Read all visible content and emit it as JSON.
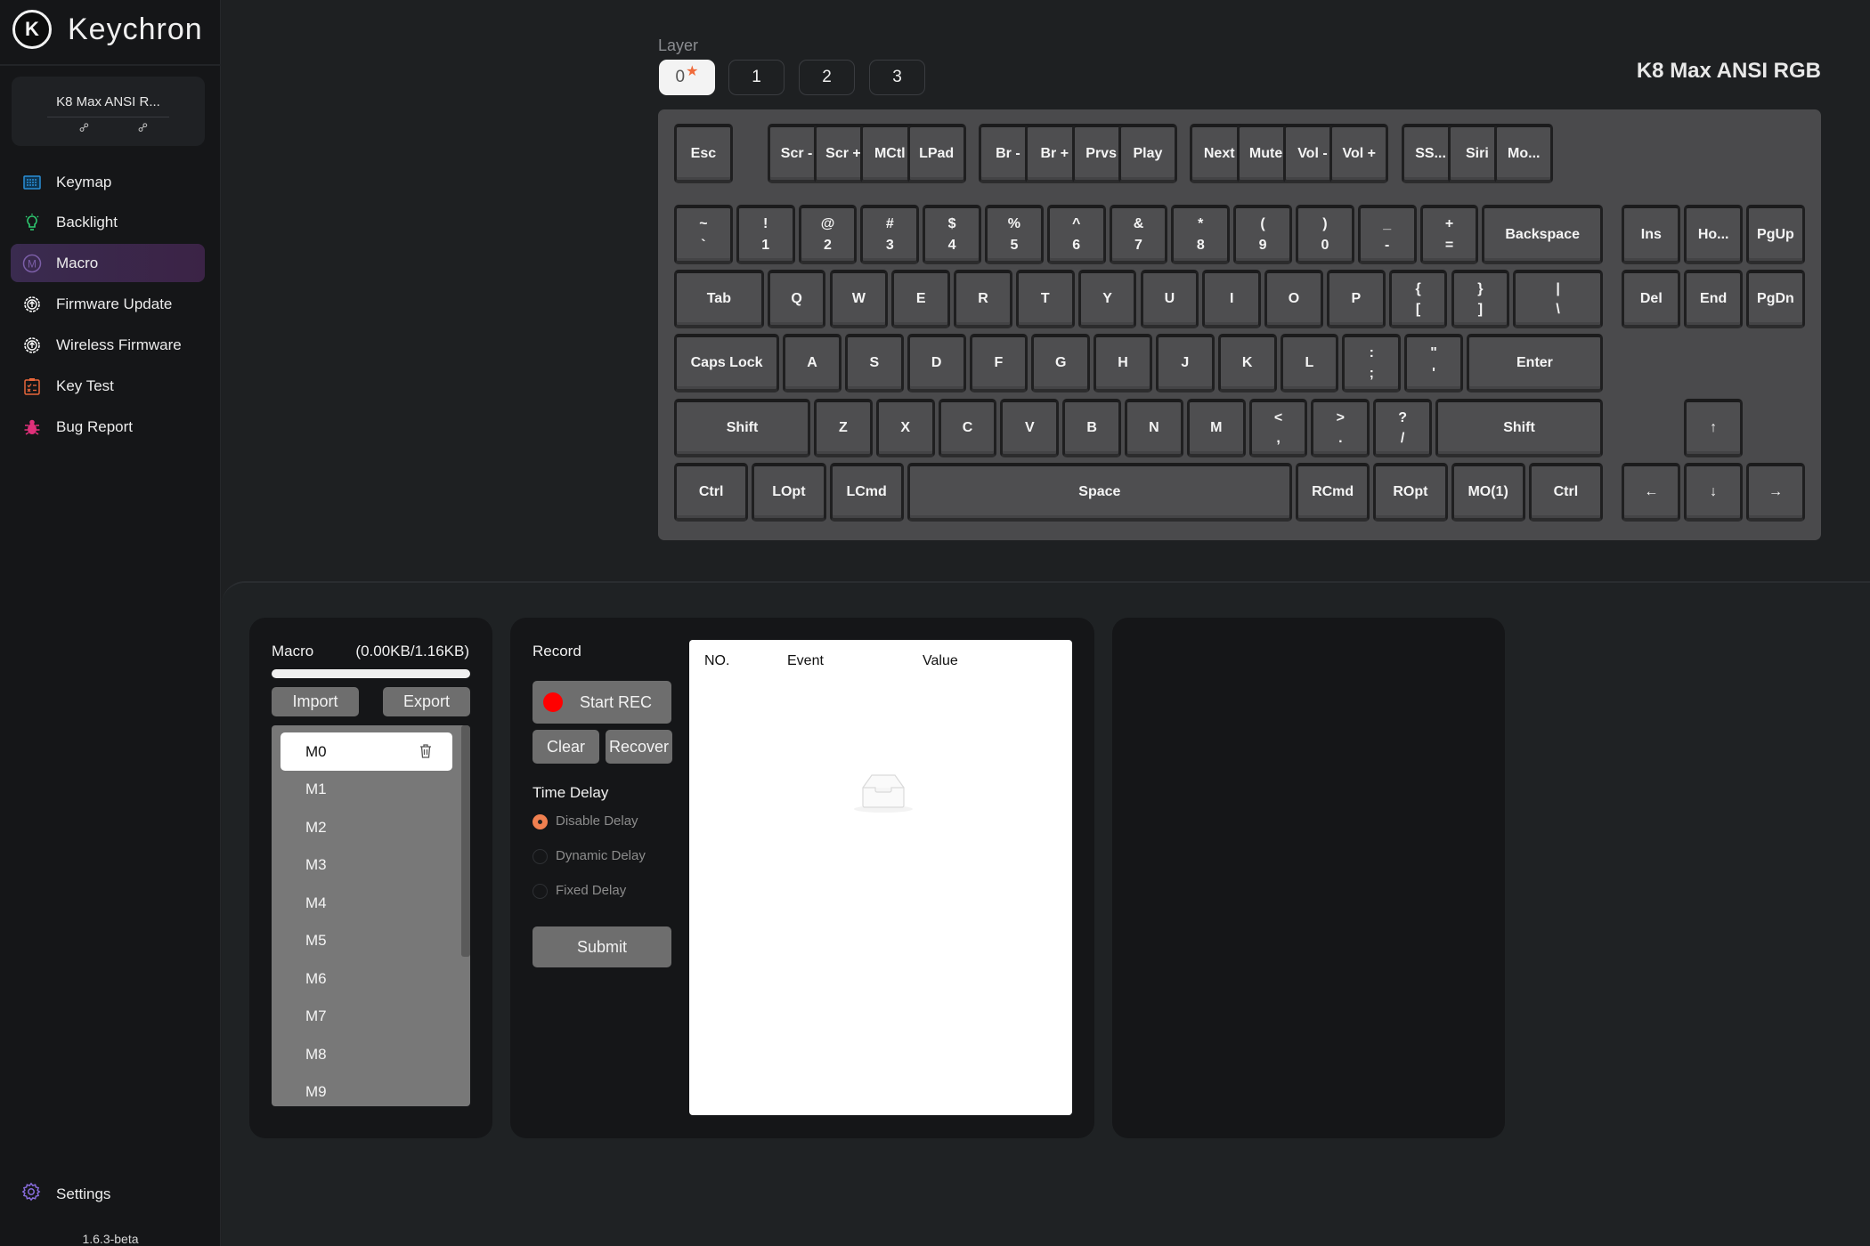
{
  "app": {
    "brand": "Keychron",
    "version": "1.6.3-beta"
  },
  "device": {
    "name_short": "K8 Max ANSI R...",
    "title": "K8 Max ANSI RGB"
  },
  "sidebar": {
    "items": [
      {
        "label": "Keymap",
        "icon": "keymap-icon",
        "color": "#2a8fd8"
      },
      {
        "label": "Backlight",
        "icon": "lightbulb-icon",
        "color": "#2ecc71"
      },
      {
        "label": "Macro",
        "icon": "macro-icon",
        "color": "#7b5ea7",
        "active": true
      },
      {
        "label": "Firmware Update",
        "icon": "firmware-upload-icon",
        "color": "#ffffff"
      },
      {
        "label": "Wireless Firmware",
        "icon": "wireless-firmware-icon",
        "color": "#ffffff"
      },
      {
        "label": "Key Test",
        "icon": "key-test-icon",
        "color": "#e8663a"
      },
      {
        "label": "Bug Report",
        "icon": "bug-icon",
        "color": "#e0307a"
      }
    ],
    "settings_label": "Settings"
  },
  "layers": {
    "label": "Layer",
    "items": [
      "0",
      "1",
      "2",
      "3"
    ],
    "active": "0"
  },
  "keyboard": {
    "rows": [
      [
        {
          "t": "Esc",
          "x": 0,
          "w": 1
        },
        {
          "t": "Scr -",
          "x": 1.5,
          "w": 1
        },
        {
          "t": "Scr +",
          "x": 2.25,
          "w": 1
        },
        {
          "t": "MCtl",
          "x": 3,
          "w": 1
        },
        {
          "t": "LPad",
          "x": 3.75,
          "w": 1
        },
        {
          "t": "Br -",
          "x": 4.9,
          "w": 1
        },
        {
          "t": "Br +",
          "x": 5.65,
          "w": 1
        },
        {
          "t": "Prvs",
          "x": 6.4,
          "w": 1
        },
        {
          "t": "Play",
          "x": 7.15,
          "w": 1
        },
        {
          "t": "Next",
          "x": 8.3,
          "w": 1
        },
        {
          "t": "Mute",
          "x": 9.05,
          "w": 1
        },
        {
          "t": "Vol -",
          "x": 9.8,
          "w": 1
        },
        {
          "t": "Vol +",
          "x": 10.55,
          "w": 1
        },
        {
          "t": "SS...",
          "x": 11.7,
          "w": 1
        },
        {
          "t": "Siri",
          "x": 12.45,
          "w": 1
        },
        {
          "t": "Mo...",
          "x": 13.2,
          "w": 1
        }
      ],
      [
        {
          "t": "~",
          "b": "`",
          "x": 0,
          "w": 1
        },
        {
          "t": "!",
          "b": "1",
          "x": 1,
          "w": 1
        },
        {
          "t": "@",
          "b": "2",
          "x": 2,
          "w": 1
        },
        {
          "t": "#",
          "b": "3",
          "x": 3,
          "w": 1
        },
        {
          "t": "$",
          "b": "4",
          "x": 4,
          "w": 1
        },
        {
          "t": "%",
          "b": "5",
          "x": 5,
          "w": 1
        },
        {
          "t": "^",
          "b": "6",
          "x": 6,
          "w": 1
        },
        {
          "t": "&",
          "b": "7",
          "x": 7,
          "w": 1
        },
        {
          "t": "*",
          "b": "8",
          "x": 8,
          "w": 1
        },
        {
          "t": "(",
          "b": "9",
          "x": 9,
          "w": 1
        },
        {
          "t": ")",
          "b": "0",
          "x": 10,
          "w": 1
        },
        {
          "t": "_",
          "b": "-",
          "x": 11,
          "w": 1
        },
        {
          "t": "+",
          "b": "=",
          "x": 12,
          "w": 1
        },
        {
          "t": "Backspace",
          "x": 13,
          "w": 2
        },
        {
          "t": "Ins",
          "x": 15.25,
          "w": 1
        },
        {
          "t": "Ho...",
          "x": 16.25,
          "w": 1
        },
        {
          "t": "PgUp",
          "x": 17.25,
          "w": 1
        }
      ],
      [
        {
          "t": "Tab",
          "x": 0,
          "w": 1.5
        },
        {
          "t": "Q",
          "x": 1.5,
          "w": 1
        },
        {
          "t": "W",
          "x": 2.5,
          "w": 1
        },
        {
          "t": "E",
          "x": 3.5,
          "w": 1
        },
        {
          "t": "R",
          "x": 4.5,
          "w": 1
        },
        {
          "t": "T",
          "x": 5.5,
          "w": 1
        },
        {
          "t": "Y",
          "x": 6.5,
          "w": 1
        },
        {
          "t": "U",
          "x": 7.5,
          "w": 1
        },
        {
          "t": "I",
          "x": 8.5,
          "w": 1
        },
        {
          "t": "O",
          "x": 9.5,
          "w": 1
        },
        {
          "t": "P",
          "x": 10.5,
          "w": 1
        },
        {
          "t": "{",
          "b": "[",
          "x": 11.5,
          "w": 1
        },
        {
          "t": "}",
          "b": "]",
          "x": 12.5,
          "w": 1
        },
        {
          "t": "|",
          "b": "\\",
          "x": 13.5,
          "w": 1.5
        },
        {
          "t": "Del",
          "x": 15.25,
          "w": 1
        },
        {
          "t": "End",
          "x": 16.25,
          "w": 1
        },
        {
          "t": "PgDn",
          "x": 17.25,
          "w": 1
        }
      ],
      [
        {
          "t": "Caps Lock",
          "x": 0,
          "w": 1.75
        },
        {
          "t": "A",
          "x": 1.75,
          "w": 1
        },
        {
          "t": "S",
          "x": 2.75,
          "w": 1
        },
        {
          "t": "D",
          "x": 3.75,
          "w": 1
        },
        {
          "t": "F",
          "x": 4.75,
          "w": 1
        },
        {
          "t": "G",
          "x": 5.75,
          "w": 1
        },
        {
          "t": "H",
          "x": 6.75,
          "w": 1
        },
        {
          "t": "J",
          "x": 7.75,
          "w": 1
        },
        {
          "t": "K",
          "x": 8.75,
          "w": 1
        },
        {
          "t": "L",
          "x": 9.75,
          "w": 1
        },
        {
          "t": ":",
          "b": ";",
          "x": 10.75,
          "w": 1
        },
        {
          "t": "\"",
          "b": "'",
          "x": 11.75,
          "w": 1
        },
        {
          "t": "Enter",
          "x": 12.75,
          "w": 2.25
        }
      ],
      [
        {
          "t": "Shift",
          "x": 0,
          "w": 2.25
        },
        {
          "t": "Z",
          "x": 2.25,
          "w": 1
        },
        {
          "t": "X",
          "x": 3.25,
          "w": 1
        },
        {
          "t": "C",
          "x": 4.25,
          "w": 1
        },
        {
          "t": "V",
          "x": 5.25,
          "w": 1
        },
        {
          "t": "B",
          "x": 6.25,
          "w": 1
        },
        {
          "t": "N",
          "x": 7.25,
          "w": 1
        },
        {
          "t": "M",
          "x": 8.25,
          "w": 1
        },
        {
          "t": "<",
          "b": ",",
          "x": 9.25,
          "w": 1
        },
        {
          "t": ">",
          "b": ".",
          "x": 10.25,
          "w": 1
        },
        {
          "t": "?",
          "b": "/",
          "x": 11.25,
          "w": 1
        },
        {
          "t": "Shift",
          "x": 12.25,
          "w": 2.75
        },
        {
          "t": "↑",
          "x": 16.25,
          "w": 1
        }
      ],
      [
        {
          "t": "Ctrl",
          "x": 0,
          "w": 1.25
        },
        {
          "t": "LOpt",
          "x": 1.25,
          "w": 1.25
        },
        {
          "t": "LCmd",
          "x": 2.5,
          "w": 1.25
        },
        {
          "t": "Space",
          "x": 3.75,
          "w": 6.25
        },
        {
          "t": "RCmd",
          "x": 10,
          "w": 1.25
        },
        {
          "t": "ROpt",
          "x": 11.25,
          "w": 1.25
        },
        {
          "t": "MO(1)",
          "x": 12.5,
          "w": 1.25
        },
        {
          "t": "Ctrl",
          "x": 13.75,
          "w": 1.25
        },
        {
          "t": "←",
          "x": 15.25,
          "w": 1
        },
        {
          "t": "↓",
          "x": 16.25,
          "w": 1
        },
        {
          "t": "→",
          "x": 17.25,
          "w": 1
        }
      ]
    ]
  },
  "macro": {
    "title": "Macro",
    "usage_text": "(0.00KB/1.16KB)",
    "usage_fraction": 0.0,
    "import_label": "Import",
    "export_label": "Export",
    "items": [
      "M0",
      "M1",
      "M2",
      "M3",
      "M4",
      "M5",
      "M6",
      "M7",
      "M8",
      "M9"
    ],
    "selected": "M0"
  },
  "record": {
    "title": "Record",
    "start_label": "Start REC",
    "clear_label": "Clear",
    "recover_label": "Recover",
    "delay_title": "Time Delay",
    "delay_options": [
      "Disable Delay",
      "Dynamic Delay",
      "Fixed Delay"
    ],
    "delay_selected": "Disable Delay",
    "submit_label": "Submit",
    "rec_color": "#ff0000"
  },
  "events_table": {
    "columns": [
      "NO.",
      "Event",
      "Value"
    ],
    "rows": [],
    "empty_icon": "empty-inbox-icon"
  },
  "colors": {
    "accent_orange": "#f08050",
    "layer_star": "#f06a3a"
  }
}
